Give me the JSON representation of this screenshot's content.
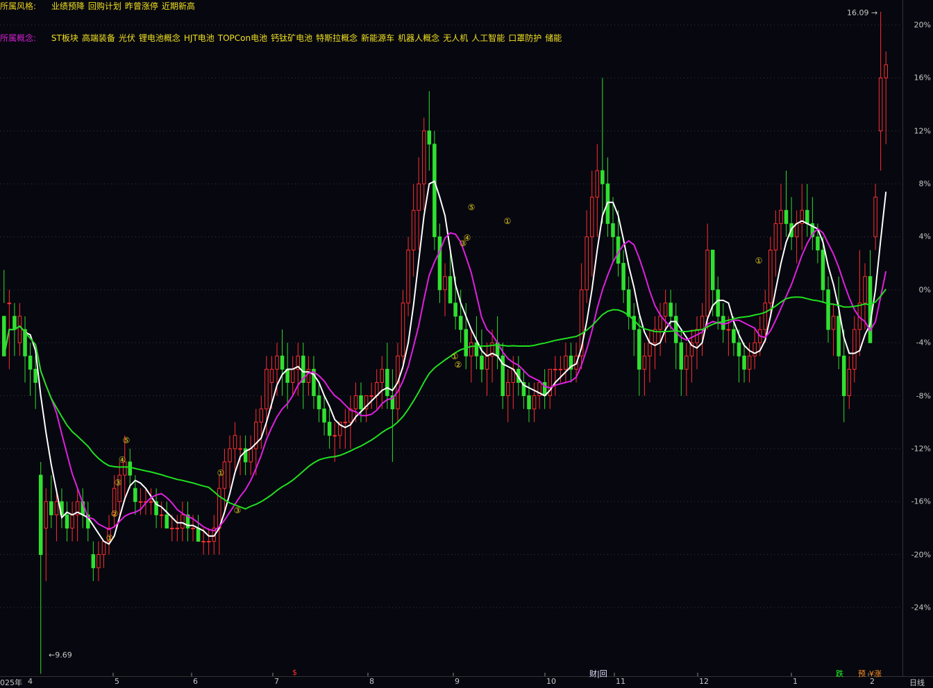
{
  "header": {
    "style_label": "所属风格:",
    "style_tags": [
      "业绩预降",
      "回购计划",
      "昨曾涨停",
      "近期新高"
    ],
    "concept_label": "所属概念:",
    "concept_tags": [
      "ST板块",
      "高端装备",
      "光伏",
      "锂电池概念",
      "HJT电池",
      "TOPCon电池",
      "钙钛矿电池",
      "特斯拉概念",
      "新能源车",
      "机器人概念",
      "无人机",
      "人工智能",
      "口罩防护",
      "储能"
    ]
  },
  "axis": {
    "y_labels": [
      "20%",
      "16%",
      "12%",
      "8%",
      "4%",
      "0%",
      "-4%",
      "-8%",
      "-12%",
      "-16%",
      "-20%",
      "-24%"
    ],
    "x_labels": [
      "025年",
      "4",
      "5",
      "6",
      "7",
      "8",
      "9",
      "10",
      "11",
      "12",
      "1",
      "2",
      "日线"
    ]
  },
  "annotations": {
    "high_label": "16.09",
    "low_label": "9.69",
    "markers": [
      {
        "text": "$",
        "color": "#ff3030"
      },
      {
        "text": "财|回",
        "color": "#e0e0ff"
      },
      {
        "text": "跌",
        "color": "#20ff20"
      },
      {
        "text": "预",
        "color": "#ff9020"
      },
      {
        "text": "¥涨",
        "color": "#ff9020"
      }
    ],
    "wave_labels": [
      "①",
      "②",
      "③",
      "④",
      "⑤"
    ]
  },
  "colors": {
    "up": "#ff3030",
    "down": "#30e030",
    "ma_short": "#ffffff",
    "ma_mid": "#e020e0",
    "ma_long": "#20e020",
    "wave_label": "#e8d020"
  },
  "chart_data": {
    "type": "candlestick",
    "timeframe": "日线",
    "y_unit": "% change",
    "ylim": [
      -28,
      22
    ],
    "high": 16.09,
    "low": 9.69,
    "candles": [
      [
        -2,
        1.5,
        -1,
        -5
      ],
      [
        -1,
        0,
        -6,
        -1
      ],
      [
        -2,
        -1,
        -5,
        -3
      ],
      [
        -4,
        -1,
        -5,
        -2
      ],
      [
        -3,
        -2,
        -7,
        -5
      ],
      [
        -5,
        -4,
        -8,
        -6
      ],
      [
        -6,
        -5,
        -9,
        -7
      ],
      [
        -14,
        -13,
        -29,
        -20
      ],
      [
        -18,
        -15,
        -22,
        -16
      ],
      [
        -16,
        -14,
        -18,
        -17
      ],
      [
        -17,
        -15,
        -19,
        -16
      ],
      [
        -16,
        -15,
        -18,
        -17
      ],
      [
        -17,
        -16,
        -19,
        -18
      ],
      [
        -18,
        -16,
        -19,
        -17
      ],
      [
        -17,
        -15,
        -19,
        -16
      ],
      [
        -16,
        -15,
        -18,
        -17
      ],
      [
        -17,
        -16,
        -19,
        -18
      ],
      [
        -20,
        -19,
        -22,
        -21
      ],
      [
        -21,
        -19,
        -22,
        -20
      ],
      [
        -20,
        -19,
        -21,
        -19
      ],
      [
        -19,
        -17,
        -20,
        -18
      ],
      [
        -17,
        -14,
        -18,
        -15
      ],
      [
        -16,
        -13,
        -17,
        -14
      ],
      [
        -14,
        -11,
        -16,
        -13
      ],
      [
        -13,
        -12,
        -15,
        -14
      ],
      [
        -15,
        -14,
        -17,
        -16
      ],
      [
        -16,
        -15,
        -17,
        -16
      ],
      [
        -16,
        -15,
        -17,
        -16
      ],
      [
        -16,
        -15,
        -17,
        -16
      ],
      [
        -16,
        -15,
        -18,
        -17
      ],
      [
        -17,
        -16,
        -18,
        -17
      ],
      [
        -17,
        -16,
        -18,
        -18
      ],
      [
        -18,
        -17,
        -19,
        -18
      ],
      [
        -18,
        -17,
        -19,
        -18
      ],
      [
        -18,
        -16,
        -19,
        -17
      ],
      [
        -17,
        -16,
        -19,
        -18
      ],
      [
        -18,
        -17,
        -19,
        -18
      ],
      [
        -18,
        -17,
        -19,
        -19
      ],
      [
        -19,
        -18,
        -20,
        -19
      ],
      [
        -19,
        -18,
        -20,
        -19
      ],
      [
        -19,
        -17,
        -20,
        -18
      ],
      [
        -18,
        -14,
        -20,
        -15
      ],
      [
        -15,
        -12,
        -17,
        -13
      ],
      [
        -13,
        -11,
        -15,
        -12
      ],
      [
        -12,
        -10,
        -14,
        -11
      ],
      [
        -12,
        -11,
        -14,
        -12
      ],
      [
        -12,
        -11,
        -14,
        -13
      ],
      [
        -13,
        -11,
        -14,
        -12
      ],
      [
        -12,
        -9,
        -14,
        -10
      ],
      [
        -10,
        -8,
        -12,
        -9
      ],
      [
        -9,
        -5,
        -11,
        -6
      ],
      [
        -7,
        -5,
        -9,
        -6
      ],
      [
        -6,
        -4,
        -8,
        -5
      ],
      [
        -5,
        -3,
        -8,
        -6
      ],
      [
        -6,
        -4,
        -9,
        -7
      ],
      [
        -7,
        -5,
        -8,
        -6
      ],
      [
        -6,
        -4,
        -8,
        -5
      ],
      [
        -5,
        -4,
        -9,
        -7
      ],
      [
        -7,
        -5,
        -8,
        -6
      ],
      [
        -6,
        -5,
        -9,
        -8
      ],
      [
        -8,
        -7,
        -10,
        -9
      ],
      [
        -9,
        -8,
        -11,
        -10
      ],
      [
        -10,
        -9,
        -12,
        -11
      ],
      [
        -11,
        -10,
        -13,
        -11
      ],
      [
        -11,
        -10,
        -12,
        -10
      ],
      [
        -10,
        -9,
        -12,
        -10
      ],
      [
        -10,
        -8,
        -12,
        -9
      ],
      [
        -9,
        -7,
        -10,
        -8
      ],
      [
        -8,
        -7,
        -10,
        -9
      ],
      [
        -9,
        -8,
        -10,
        -8
      ],
      [
        -8,
        -7,
        -9,
        -8
      ],
      [
        -8,
        -6,
        -9,
        -7
      ],
      [
        -7,
        -5,
        -9,
        -6
      ],
      [
        -6,
        -4,
        -9,
        -8
      ],
      [
        -8,
        -6,
        -13,
        -9
      ],
      [
        -9,
        -4,
        -10,
        -5
      ],
      [
        -5,
        0,
        -6,
        -1
      ],
      [
        -1,
        4,
        -2,
        3
      ],
      [
        3,
        8,
        1,
        6
      ],
      [
        6,
        10,
        3,
        8
      ],
      [
        8,
        13,
        6,
        12
      ],
      [
        12,
        15,
        9,
        11
      ],
      [
        11,
        12,
        3,
        4
      ],
      [
        4,
        5,
        -1,
        0
      ],
      [
        0,
        2,
        -2,
        1
      ],
      [
        1,
        3,
        -1,
        -1
      ],
      [
        -1,
        1,
        -3,
        -2
      ],
      [
        -2,
        0,
        -4,
        -3
      ],
      [
        -3,
        -1,
        -6,
        -5
      ],
      [
        -5,
        -3,
        -7,
        -4
      ],
      [
        -4,
        -2,
        -6,
        -5
      ],
      [
        -5,
        -3,
        -7,
        -6
      ],
      [
        -6,
        -4,
        -8,
        -5
      ],
      [
        -5,
        -3,
        -7,
        -4
      ],
      [
        -4,
        -2,
        -6,
        -5
      ],
      [
        -5,
        -4,
        -9,
        -8
      ],
      [
        -8,
        -6,
        -10,
        -7
      ],
      [
        -7,
        -5,
        -9,
        -6
      ],
      [
        -6,
        -5,
        -8,
        -7
      ],
      [
        -7,
        -6,
        -9,
        -8
      ],
      [
        -8,
        -7,
        -10,
        -9
      ],
      [
        -9,
        -7,
        -10,
        -8
      ],
      [
        -8,
        -7,
        -9,
        -7
      ],
      [
        -7,
        -6,
        -9,
        -8
      ],
      [
        -8,
        -6,
        -9,
        -6
      ],
      [
        -6,
        -5,
        -8,
        -6
      ],
      [
        -6,
        -5,
        -7,
        -6
      ],
      [
        -6,
        -4,
        -7,
        -5
      ],
      [
        -5,
        -4,
        -7,
        -6
      ],
      [
        -6,
        -4,
        -7,
        -5
      ],
      [
        -5,
        2,
        -6,
        0
      ],
      [
        0,
        6,
        -1,
        4
      ],
      [
        4,
        9,
        1,
        7
      ],
      [
        7,
        11,
        4,
        9
      ],
      [
        9,
        16,
        5,
        8
      ],
      [
        8,
        10,
        4,
        5
      ],
      [
        5,
        7,
        2,
        4
      ],
      [
        4,
        6,
        1,
        2
      ],
      [
        2,
        3,
        -1,
        0
      ],
      [
        0,
        1,
        -3,
        -2
      ],
      [
        -2,
        -1,
        -5,
        -3
      ],
      [
        -3,
        -2,
        -8,
        -6
      ],
      [
        -6,
        -4,
        -8,
        -5
      ],
      [
        -5,
        -3,
        -7,
        -4
      ],
      [
        -4,
        -2,
        -6,
        -3
      ],
      [
        -3,
        -1,
        -5,
        -2
      ],
      [
        -2,
        0,
        -4,
        -1
      ],
      [
        -1,
        0,
        -3,
        -2
      ],
      [
        -2,
        -1,
        -6,
        -4
      ],
      [
        -4,
        -3,
        -8,
        -6
      ],
      [
        -6,
        -4,
        -8,
        -5
      ],
      [
        -5,
        -3,
        -7,
        -4
      ],
      [
        -4,
        -2,
        -6,
        -3
      ],
      [
        -3,
        -1,
        -5,
        -2
      ],
      [
        -2,
        5,
        -3,
        3
      ],
      [
        3,
        1,
        -2,
        0
      ],
      [
        0,
        1,
        -3,
        -2
      ],
      [
        -2,
        -1,
        -4,
        -3
      ],
      [
        -3,
        -2,
        -5,
        -3
      ],
      [
        -3,
        -2,
        -5,
        -4
      ],
      [
        -4,
        -3,
        -7,
        -5
      ],
      [
        -5,
        -4,
        -7,
        -6
      ],
      [
        -6,
        -4,
        -7,
        -5
      ],
      [
        -5,
        -3,
        -6,
        -4
      ],
      [
        -4,
        -2,
        -5,
        -3
      ],
      [
        -3,
        0,
        -4,
        -1
      ],
      [
        -1,
        4,
        -2,
        3
      ],
      [
        3,
        6,
        1,
        5
      ],
      [
        5,
        8,
        3,
        6
      ],
      [
        6,
        9,
        4,
        5
      ],
      [
        5,
        7,
        3,
        4
      ],
      [
        4,
        6,
        2,
        5
      ],
      [
        5,
        8,
        3,
        6
      ],
      [
        6,
        8,
        4,
        5
      ],
      [
        5,
        7,
        3,
        4
      ],
      [
        4,
        5,
        2,
        3
      ],
      [
        3,
        4,
        -1,
        0
      ],
      [
        0,
        1,
        -4,
        -3
      ],
      [
        -3,
        -1,
        -5,
        -2
      ],
      [
        -2,
        1,
        -6,
        -5
      ],
      [
        -5,
        -3,
        -10,
        -8
      ],
      [
        -8,
        -5,
        -9,
        -6
      ],
      [
        -6,
        -2,
        -7,
        -3
      ],
      [
        -3,
        3,
        -5,
        -1
      ],
      [
        -1,
        2,
        -3,
        1
      ],
      [
        1,
        3,
        -3,
        -4
      ],
      [
        4,
        8,
        3,
        7
      ],
      [
        12,
        21,
        9,
        16
      ],
      [
        16,
        18,
        11,
        17
      ]
    ]
  }
}
